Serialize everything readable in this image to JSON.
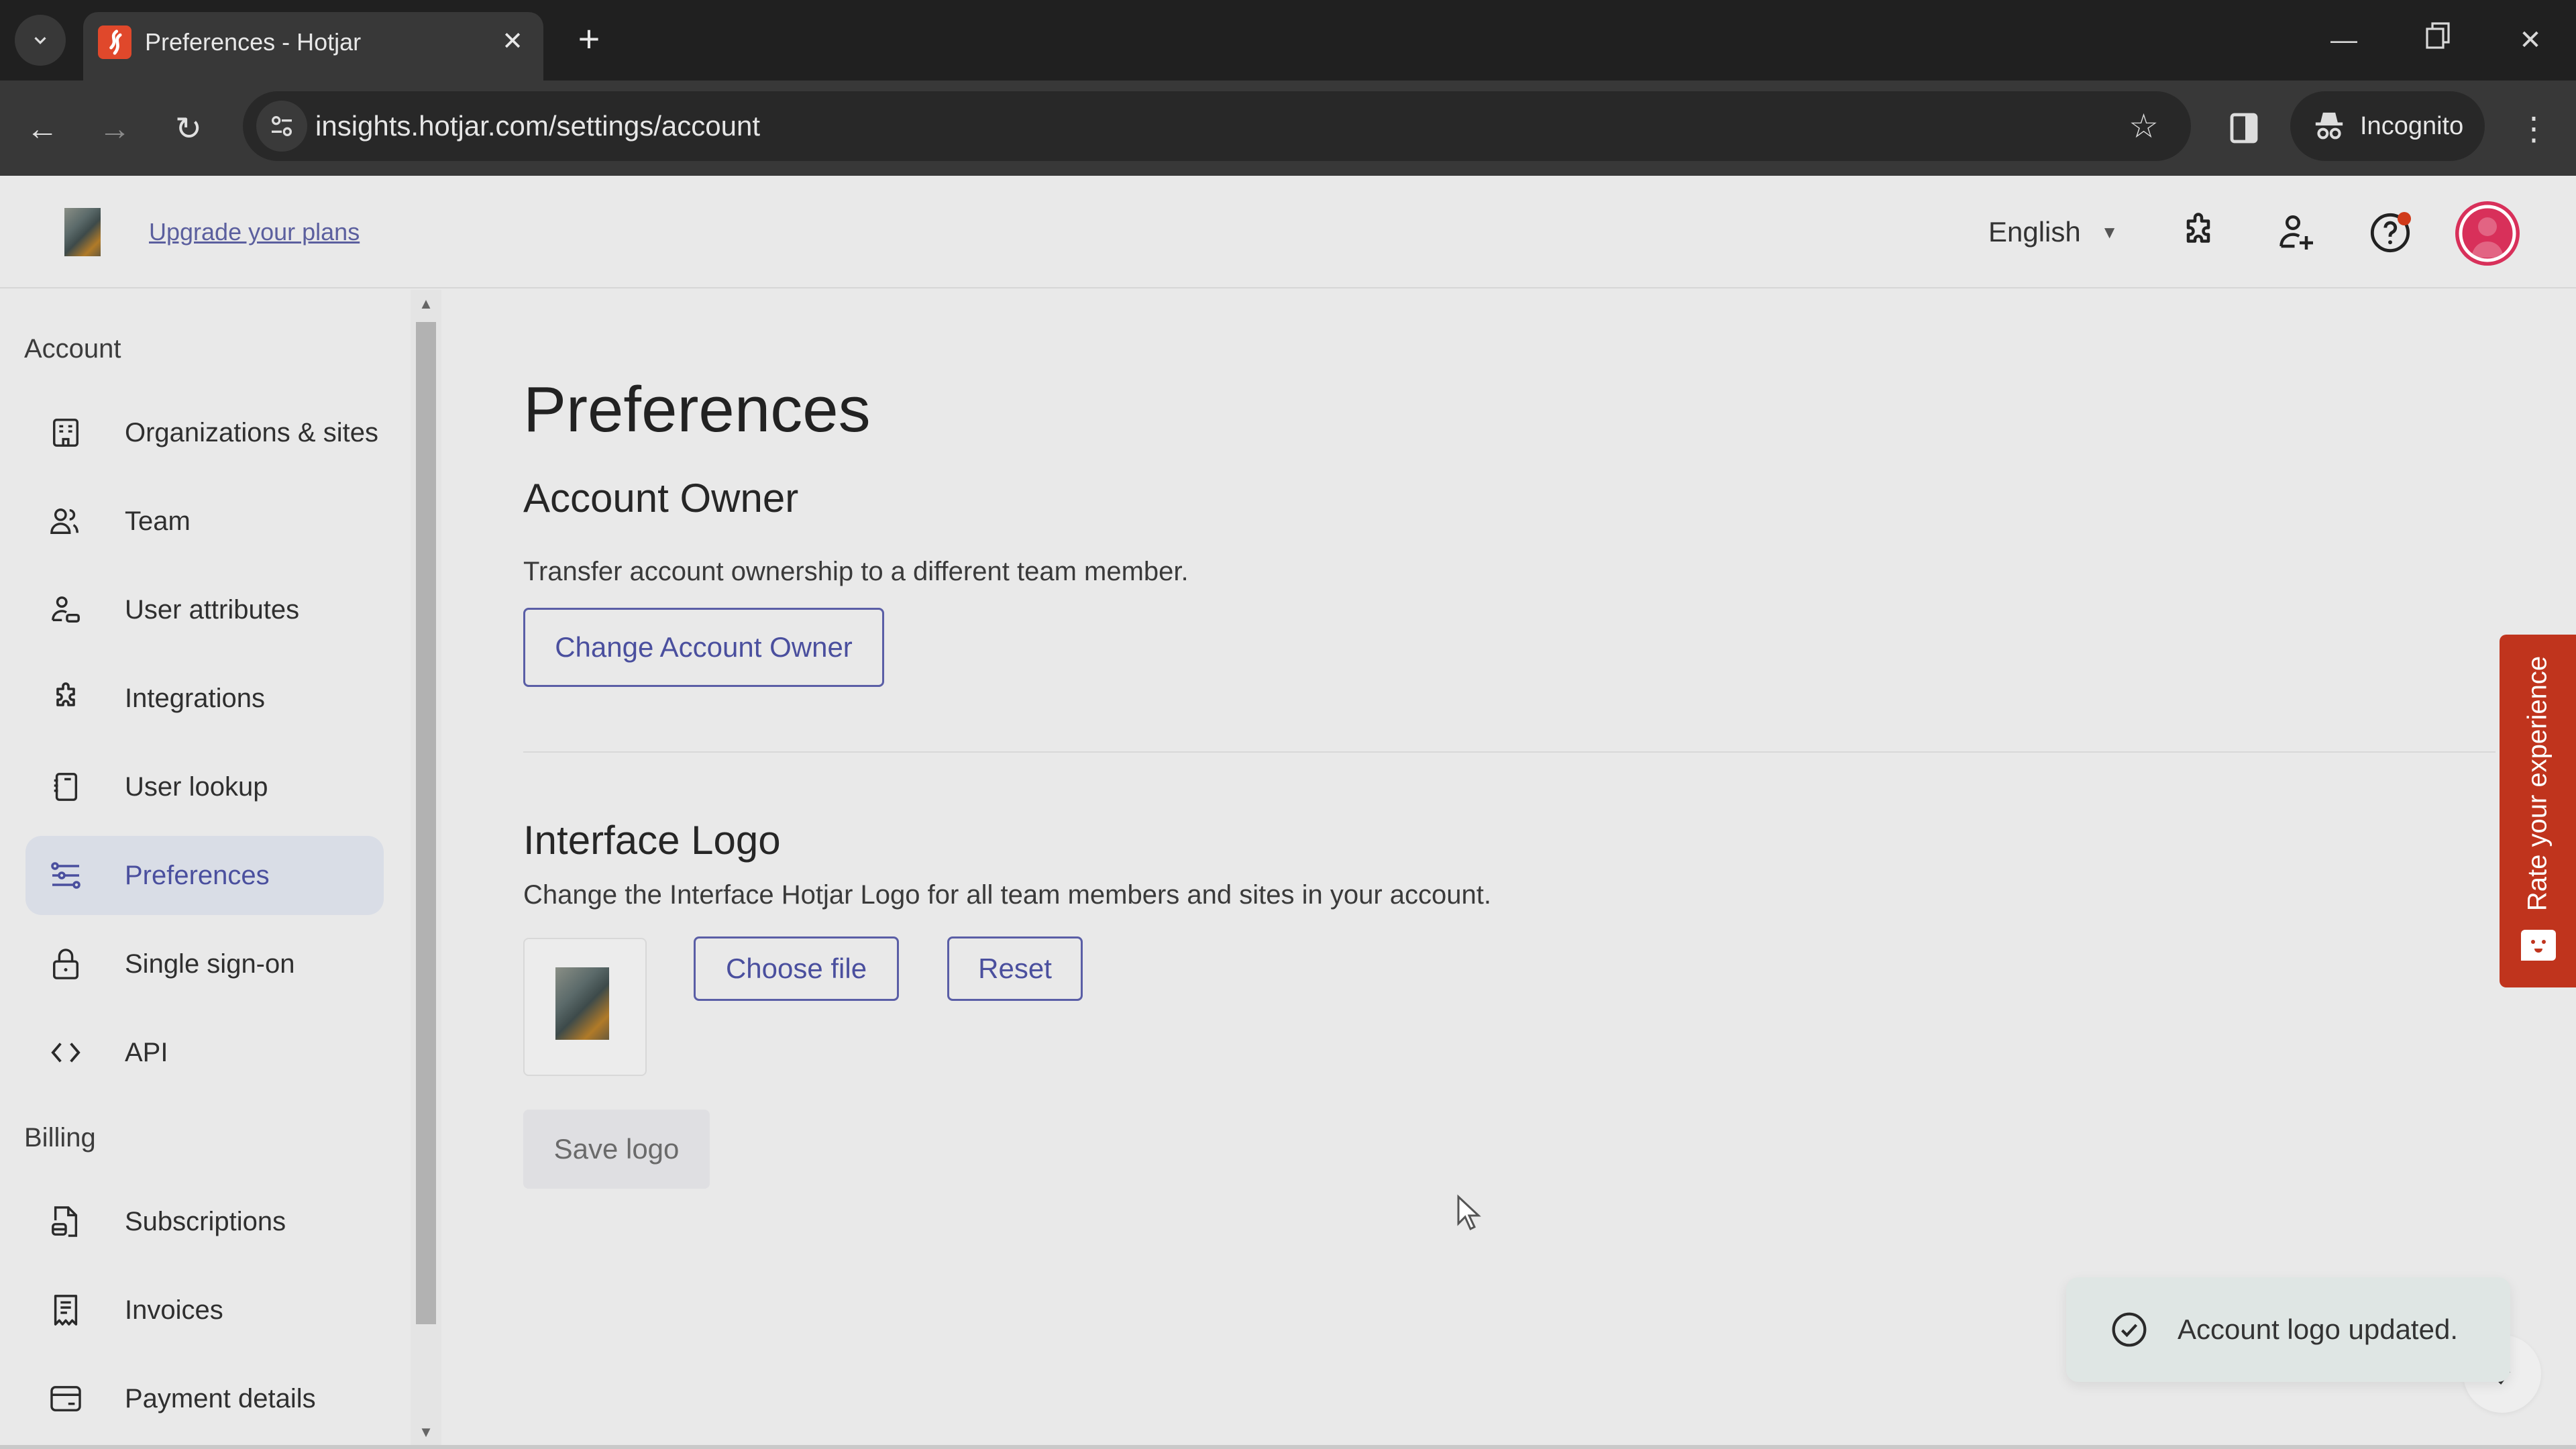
{
  "browser": {
    "tab_title": "Preferences - Hotjar",
    "url": "insights.hotjar.com/settings/account",
    "incognito_label": "Incognito"
  },
  "header": {
    "upgrade_link": "Upgrade your plans",
    "language": "English"
  },
  "sidebar": {
    "sections": [
      {
        "title": "Account",
        "items": [
          {
            "label": "Organizations & sites",
            "icon": "building-icon"
          },
          {
            "label": "Team",
            "icon": "team-icon"
          },
          {
            "label": "User attributes",
            "icon": "user-attributes-icon"
          },
          {
            "label": "Integrations",
            "icon": "puzzle-icon"
          },
          {
            "label": "User lookup",
            "icon": "notebook-icon"
          },
          {
            "label": "Preferences",
            "icon": "sliders-icon",
            "active": true
          },
          {
            "label": "Single sign-on",
            "icon": "lock-icon"
          },
          {
            "label": "API",
            "icon": "code-icon"
          }
        ]
      },
      {
        "title": "Billing",
        "items": [
          {
            "label": "Subscriptions",
            "icon": "subscription-icon"
          },
          {
            "label": "Invoices",
            "icon": "receipt-icon"
          },
          {
            "label": "Payment details",
            "icon": "credit-card-icon"
          }
        ]
      }
    ]
  },
  "main": {
    "page_title": "Preferences",
    "account_owner": {
      "title": "Account Owner",
      "description": "Transfer account ownership to a different team member.",
      "button": "Change Account Owner"
    },
    "interface_logo": {
      "title": "Interface Logo",
      "description": "Change the Interface Hotjar Logo for all team members and sites in your account.",
      "choose_file": "Choose file",
      "reset": "Reset",
      "save": "Save logo"
    }
  },
  "feedback_tab": {
    "label": "Rate your experience"
  },
  "toast": {
    "message": "Account logo updated."
  },
  "colors": {
    "accent": "#4a4f9e",
    "feedback": "#c0341d",
    "avatar": "#d8305a",
    "active_item_bg": "#d9dde6"
  }
}
